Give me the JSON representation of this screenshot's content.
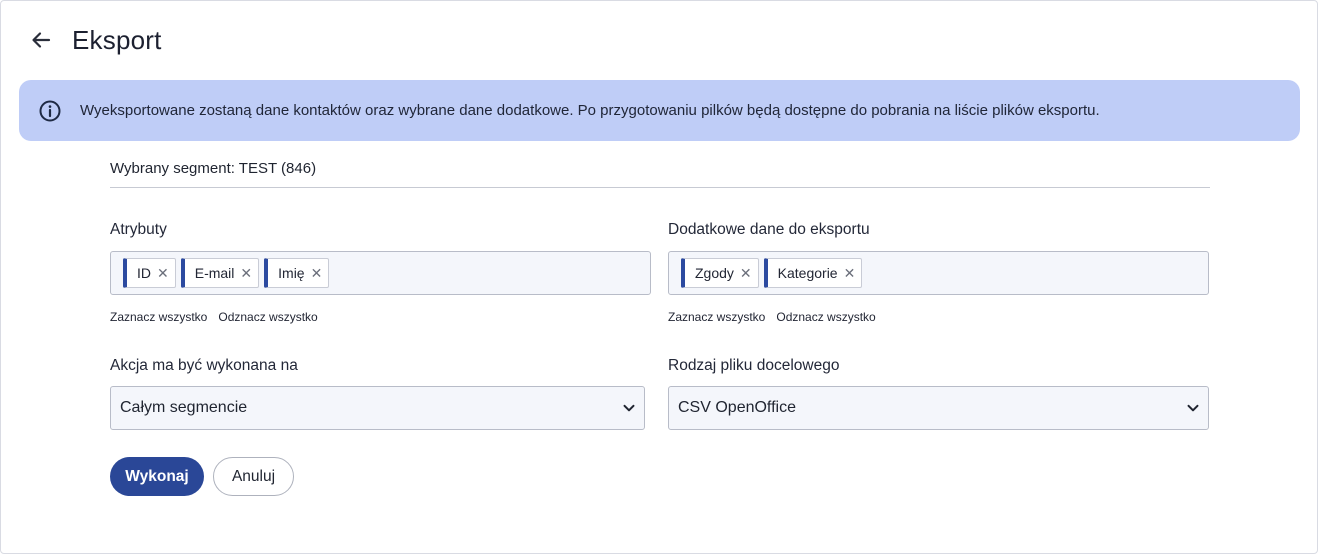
{
  "header": {
    "title": "Eksport",
    "back_icon": "arrow-left-icon"
  },
  "alert": {
    "icon": "info-icon",
    "text": "Wyeksportowane zostaną dane kontaktów oraz wybrane dane dodatkowe. Po przygotowaniu pilków będą dostępne do pobrania na liście plików eksportu."
  },
  "segment": {
    "text": "Wybrany segment: TEST (846)"
  },
  "attributes": {
    "label": "Atrybuty",
    "tags": [
      "ID",
      "E-mail",
      "Imię"
    ],
    "select_all": "Zaznacz wszystko",
    "deselect_all": "Odznacz wszystko"
  },
  "additional": {
    "label": "Dodatkowe dane do eksportu",
    "tags": [
      "Zgody",
      "Kategorie"
    ],
    "select_all": "Zaznacz wszystko",
    "deselect_all": "Odznacz wszystko"
  },
  "action_target": {
    "label": "Akcja ma być wykonana na",
    "value": "Całym segmencie"
  },
  "file_type": {
    "label": "Rodzaj pliku docelowego",
    "value": "CSV OpenOffice"
  },
  "buttons": {
    "submit": "Wykonaj",
    "cancel": "Anuluj"
  },
  "colors": {
    "accent": "#2a4797",
    "alert_bg": "#bfcdf7",
    "tag_accent": "#2c4aa0"
  }
}
